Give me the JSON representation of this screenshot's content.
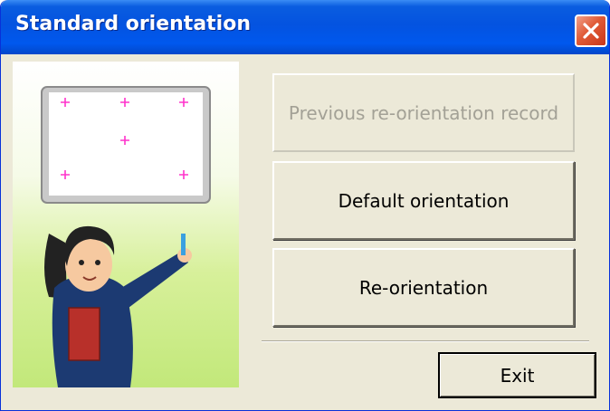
{
  "window": {
    "title": "Standard orientation"
  },
  "buttons": {
    "previous_record": "Previous re-orientation record",
    "previous_record_enabled": false,
    "default_orientation": "Default orientation",
    "re_orientation": "Re-orientation",
    "exit": "Exit"
  },
  "colors": {
    "titlebar": "#0453e0",
    "close_button": "#e05a36",
    "calibration_marks": "#ff33cc",
    "dialog_background": "#ece9d8"
  }
}
